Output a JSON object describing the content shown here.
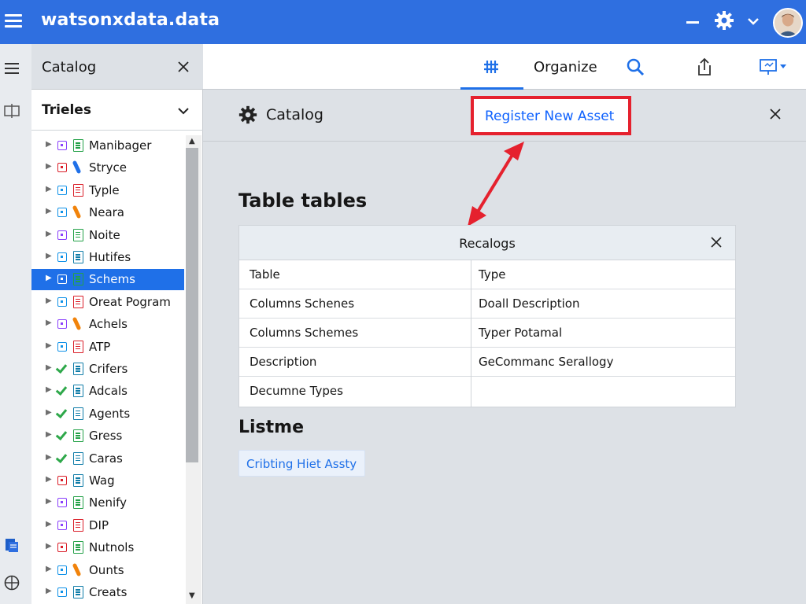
{
  "app": {
    "title": "watsonxdata.data",
    "colors": {
      "topbar": "#2f6fe0",
      "accent": "#1f70e8",
      "highlight": "#e5212e"
    }
  },
  "catalog_panel": {
    "title": "Catalog",
    "tree_header": "Trieles",
    "items": [
      {
        "label": "Manibager",
        "kind": "purple",
        "icon": "doc-green"
      },
      {
        "label": "Stryce",
        "kind": "red",
        "icon": "pen-blue"
      },
      {
        "label": "Typle",
        "kind": "teal",
        "icon": "doc-red"
      },
      {
        "label": "Neara",
        "kind": "teal",
        "icon": "pen-orange"
      },
      {
        "label": "Noite",
        "kind": "purple",
        "icon": "doc-green"
      },
      {
        "label": "Hutifes",
        "kind": "teal",
        "icon": "doc-teal"
      },
      {
        "label": "Schems",
        "kind": "purple",
        "icon": "doc-green",
        "selected": true
      },
      {
        "label": "Oreat Pogram",
        "kind": "teal",
        "icon": "doc-red"
      },
      {
        "label": "Achels",
        "kind": "purple",
        "icon": "pen-orange"
      },
      {
        "label": "ATP",
        "kind": "teal",
        "icon": "doc-red"
      },
      {
        "label": "Crifers",
        "kind": "check",
        "icon": "doc-teal"
      },
      {
        "label": "Adcals",
        "kind": "check",
        "icon": "doc-teal"
      },
      {
        "label": "Agents",
        "kind": "check",
        "icon": "doc-teal"
      },
      {
        "label": "Gress",
        "kind": "check",
        "icon": "doc-green"
      },
      {
        "label": "Caras",
        "kind": "check",
        "icon": "doc-teal"
      },
      {
        "label": "Wag",
        "kind": "red",
        "icon": "doc-teal"
      },
      {
        "label": "Nenify",
        "kind": "purple",
        "icon": "doc-green"
      },
      {
        "label": "DIP",
        "kind": "purple",
        "icon": "doc-red"
      },
      {
        "label": "Nutnols",
        "kind": "red",
        "icon": "doc-green"
      },
      {
        "label": "Ounts",
        "kind": "teal",
        "icon": "pen-orange"
      },
      {
        "label": "Creats",
        "kind": "teal",
        "icon": "doc-teal"
      }
    ]
  },
  "tabs": {
    "organize_label": "Organize"
  },
  "content": {
    "header_title": "Catalog",
    "register_button": "Register New Asset",
    "section_title": "Table tables",
    "dialog": {
      "title": "Recalogs",
      "rows": [
        [
          "Table",
          "Type"
        ],
        [
          "Columns Schenes",
          "Doall Description"
        ],
        [
          "Columns Schemes",
          "Typer Potamal"
        ],
        [
          "Description",
          "GeCommanc Serallogy"
        ],
        [
          "Decumne Types",
          ""
        ]
      ]
    },
    "list_title": "Listme",
    "chip_label": "Cribting Hiet Assty"
  }
}
